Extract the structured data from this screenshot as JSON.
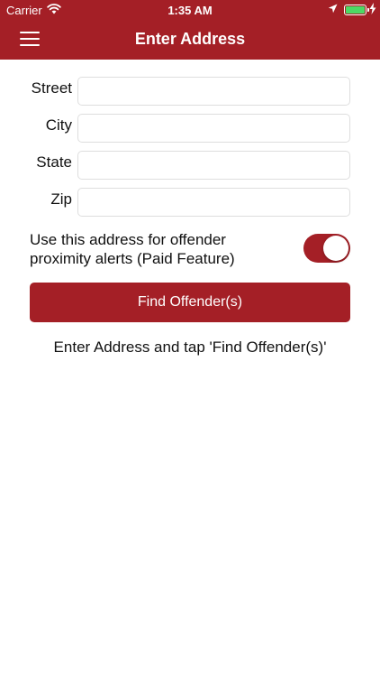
{
  "status_bar": {
    "carrier": "Carrier",
    "time": "1:35 AM"
  },
  "nav": {
    "title": "Enter Address"
  },
  "form": {
    "street_label": "Street",
    "street_value": "",
    "city_label": "City",
    "city_value": "",
    "state_label": "State",
    "state_value": "",
    "zip_label": "Zip",
    "zip_value": ""
  },
  "alerts": {
    "label_line1": "Use this address for offender",
    "label_line2": "proximity alerts (Paid Feature)",
    "toggle_on": true
  },
  "actions": {
    "find_label": "Find Offender(s)"
  },
  "hint": "Enter Address and tap 'Find Offender(s)'",
  "colors": {
    "accent": "#a41f26",
    "battery": "#4cd964"
  }
}
